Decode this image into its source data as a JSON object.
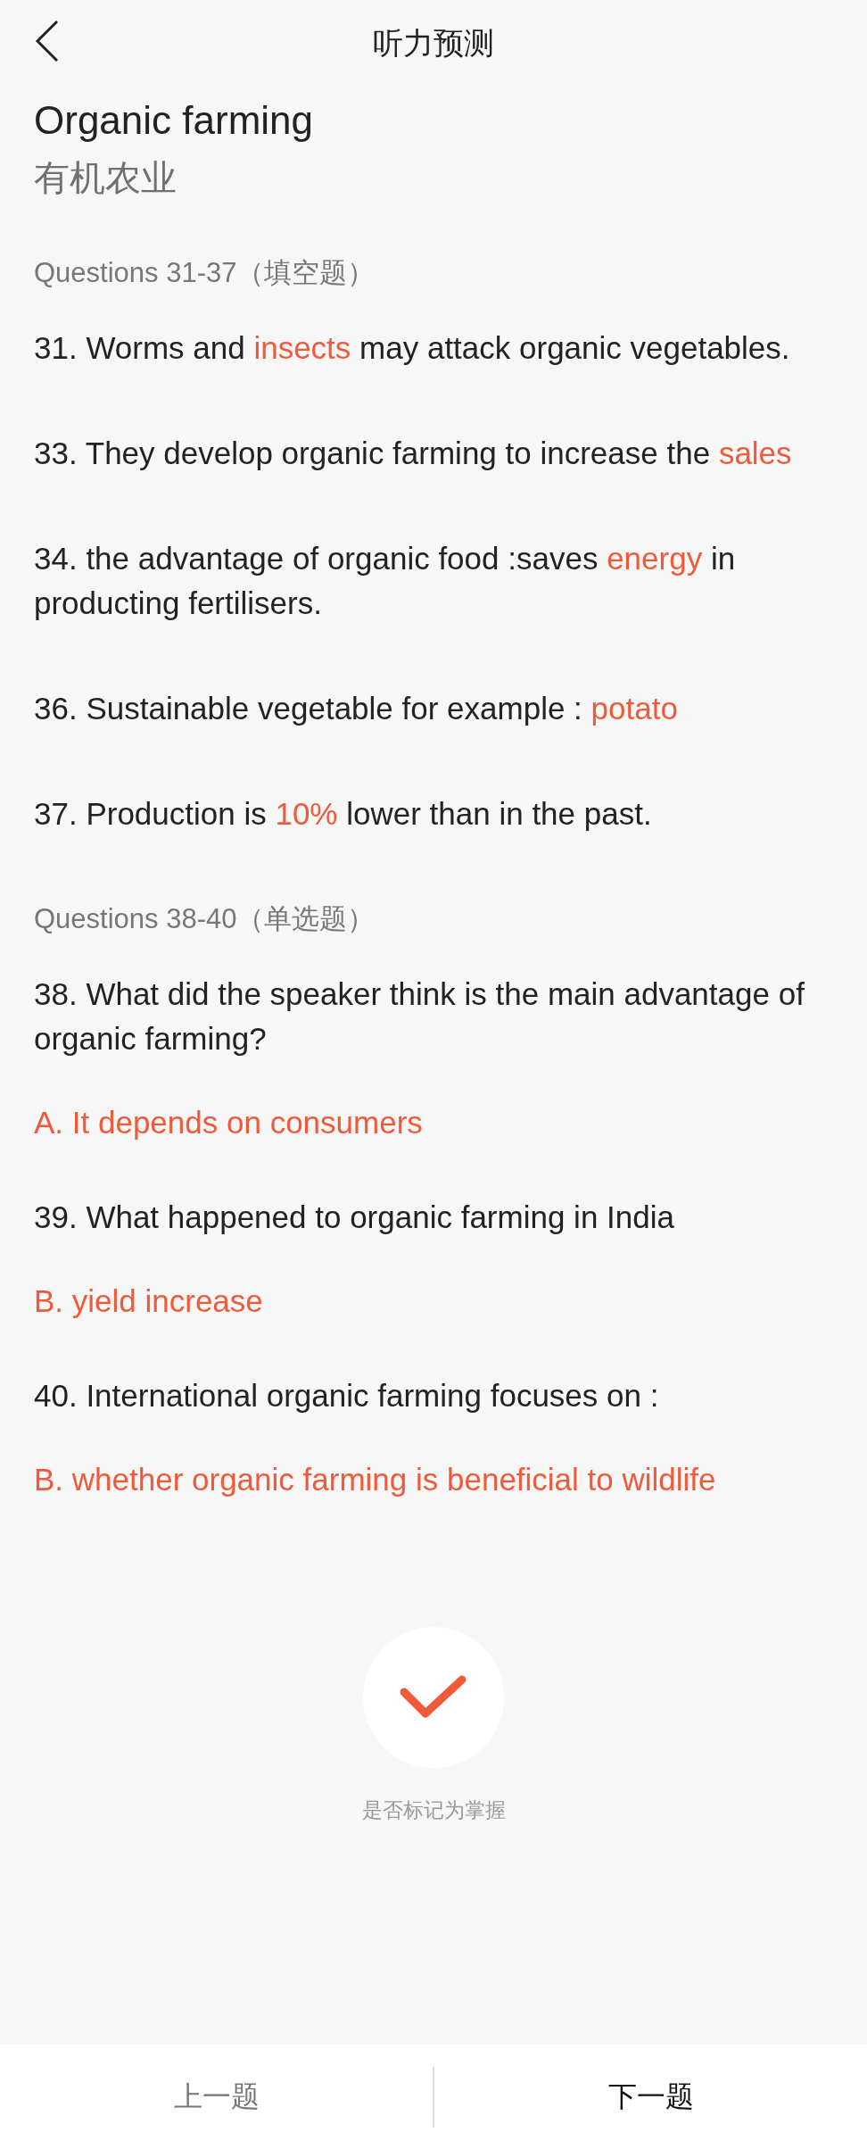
{
  "header": {
    "title": "听力预测"
  },
  "title": {
    "english": "Organic farming",
    "chinese": "有机农业"
  },
  "sections": [
    {
      "heading": "Questions 31-37（填空题）",
      "items": [
        {
          "kind": "fill",
          "segments": [
            {
              "text": "31. Worms and ",
              "answer": false
            },
            {
              "text": "insects",
              "answer": true
            },
            {
              "text": " may attack organic vegetables.",
              "answer": false
            }
          ]
        },
        {
          "kind": "fill",
          "segments": [
            {
              "text": "33. They develop organic farming to increase the ",
              "answer": false
            },
            {
              "text": "sales",
              "answer": true
            }
          ]
        },
        {
          "kind": "fill",
          "segments": [
            {
              "text": "34. the advantage of organic food :saves ",
              "answer": false
            },
            {
              "text": "energy",
              "answer": true
            },
            {
              "text": " in producting fertilisers.",
              "answer": false
            }
          ]
        },
        {
          "kind": "fill",
          "segments": [
            {
              "text": "36. Sustainable vegetable for example : ",
              "answer": false
            },
            {
              "text": "potato",
              "answer": true
            }
          ]
        },
        {
          "kind": "fill",
          "segments": [
            {
              "text": "37. Production is ",
              "answer": false
            },
            {
              "text": "10%",
              "answer": true
            },
            {
              "text": " lower than in the past.",
              "answer": false
            }
          ]
        }
      ]
    },
    {
      "heading": "Questions 38-40（单选题）",
      "items": [
        {
          "kind": "question",
          "text": "38. What did the speaker think is the main advantage of organic farming?"
        },
        {
          "kind": "choice",
          "text": "A. It depends on consumers"
        },
        {
          "kind": "question",
          "text": "39. What happened to organic farming in India"
        },
        {
          "kind": "choice",
          "text": "B. yield increase"
        },
        {
          "kind": "question",
          "text": "40. International organic farming focuses on :"
        },
        {
          "kind": "choice",
          "text": "B. whether organic farming is beneficial to wildlife"
        }
      ]
    }
  ],
  "mastery": {
    "label": "是否标记为掌握"
  },
  "nav": [
    {
      "label": "上一题",
      "disabled": true
    },
    {
      "label": "下一题",
      "disabled": false
    }
  ]
}
